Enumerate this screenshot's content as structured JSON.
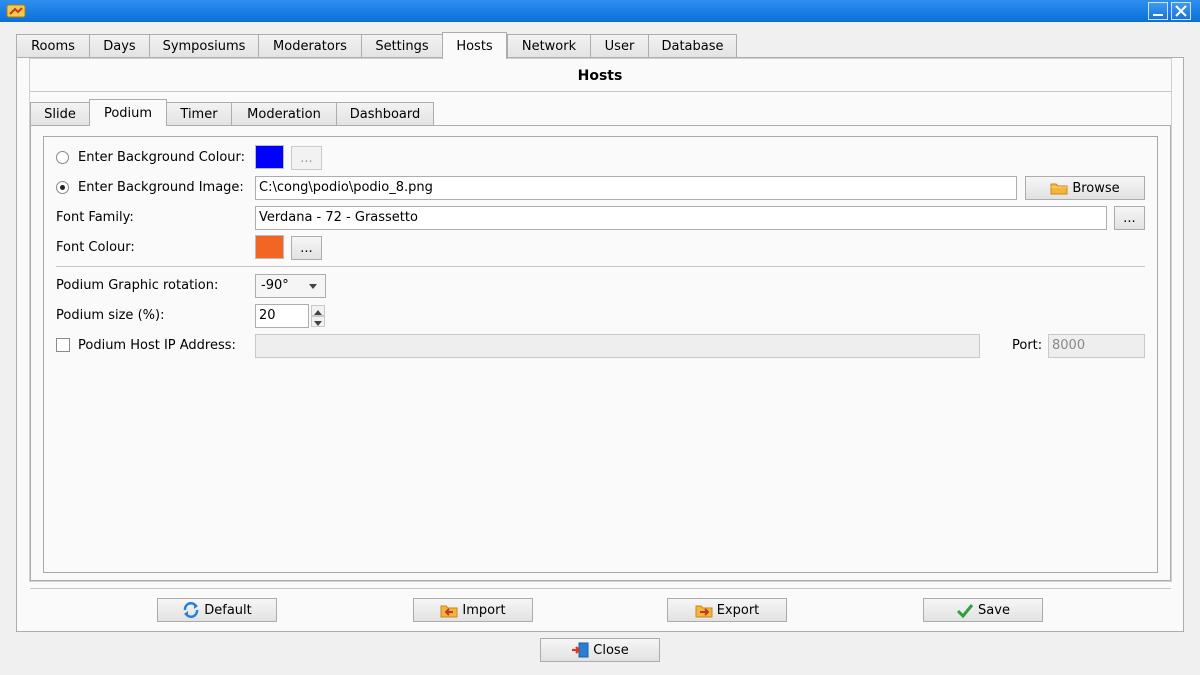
{
  "window": {
    "minimize_icon": "minimize-icon",
    "close_icon": "close-icon"
  },
  "main_tabs": [
    "Rooms",
    "Days",
    "Symposiums",
    "Moderators",
    "Settings",
    "Hosts",
    "Network",
    "User",
    "Database"
  ],
  "active_main_tab": "Hosts",
  "section_title": "Hosts",
  "sub_tabs": [
    "Slide",
    "Podium",
    "Timer",
    "Moderation",
    "Dashboard"
  ],
  "active_sub_tab": "Podium",
  "form": {
    "bg_colour_label": "Enter Background Colour:",
    "bg_colour_value": "#0000ff",
    "bg_image_label": "Enter Background Image:",
    "bg_image_path": "C:\\cong\\podio\\podio_8.png",
    "browse_label": "Browse",
    "font_family_label": "Font Family:",
    "font_family_value": "Verdana - 72 - Grassetto",
    "font_colour_label": "Font Colour:",
    "font_colour_value": "#f26522",
    "ellipsis": "...",
    "rotation_label": "Podium Graphic rotation:",
    "rotation_value": "-90°",
    "size_label": "Podium size (%):",
    "size_value": "20",
    "host_ip_label": "Podium Host IP Address:",
    "host_ip_value": "",
    "port_label": "Port:",
    "port_placeholder": "8000"
  },
  "actions": {
    "default": "Default",
    "import": "Import",
    "export": "Export",
    "save": "Save",
    "close": "Close"
  }
}
